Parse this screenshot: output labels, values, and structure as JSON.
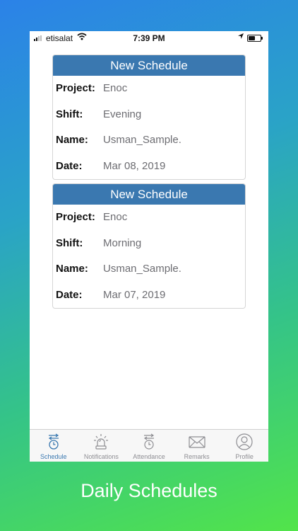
{
  "status_bar": {
    "carrier": "etisalat",
    "time": "7:39 PM"
  },
  "schedules": [
    {
      "title": "New Schedule",
      "fields": [
        {
          "label": "Project:",
          "value": "Enoc"
        },
        {
          "label": "Shift:",
          "value": "Evening"
        },
        {
          "label": "Name:",
          "value": "Usman_Sample."
        },
        {
          "label": "Date:",
          "value": "Mar 08, 2019"
        }
      ]
    },
    {
      "title": "New Schedule",
      "fields": [
        {
          "label": "Project:",
          "value": "Enoc"
        },
        {
          "label": "Shift:",
          "value": "Morning"
        },
        {
          "label": "Name:",
          "value": "Usman_Sample."
        },
        {
          "label": "Date:",
          "value": "Mar 07, 2019"
        }
      ]
    }
  ],
  "tabs": [
    {
      "label": "Schedule",
      "icon": "schedule-clock-icon",
      "active": true
    },
    {
      "label": "Notifications",
      "icon": "alarm-siren-icon",
      "active": false
    },
    {
      "label": "Attendance",
      "icon": "attendance-clock-icon",
      "active": false
    },
    {
      "label": "Remarks",
      "icon": "envelope-icon",
      "active": false
    },
    {
      "label": "Profile",
      "icon": "person-icon",
      "active": false
    }
  ],
  "colors": {
    "accent": "#3a78b0",
    "inactive": "#8e8e93"
  },
  "caption": "Daily Schedules"
}
